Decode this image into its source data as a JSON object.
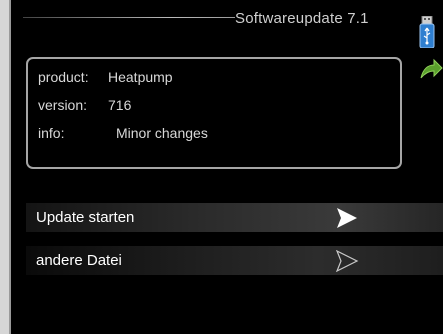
{
  "header": {
    "title": "Softwareupdate 7.1"
  },
  "info": {
    "rows": [
      {
        "key": "product:",
        "value": "Heatpump"
      },
      {
        "key": "version:",
        "value": "716"
      },
      {
        "key": "info:",
        "value": "Minor changes"
      }
    ]
  },
  "menu": {
    "items": [
      {
        "label": "Update starten",
        "selected": true
      },
      {
        "label": "andere Datei",
        "selected": false
      }
    ]
  },
  "icons": {
    "usb": "usb-stick-icon",
    "back": "green-back-arrow-icon"
  },
  "colors": {
    "background": "#000000",
    "text": "#ffffff",
    "box_border": "#a6a6a6",
    "back_arrow": "#5aa02c",
    "usb_blue": "#2f7fd0"
  }
}
